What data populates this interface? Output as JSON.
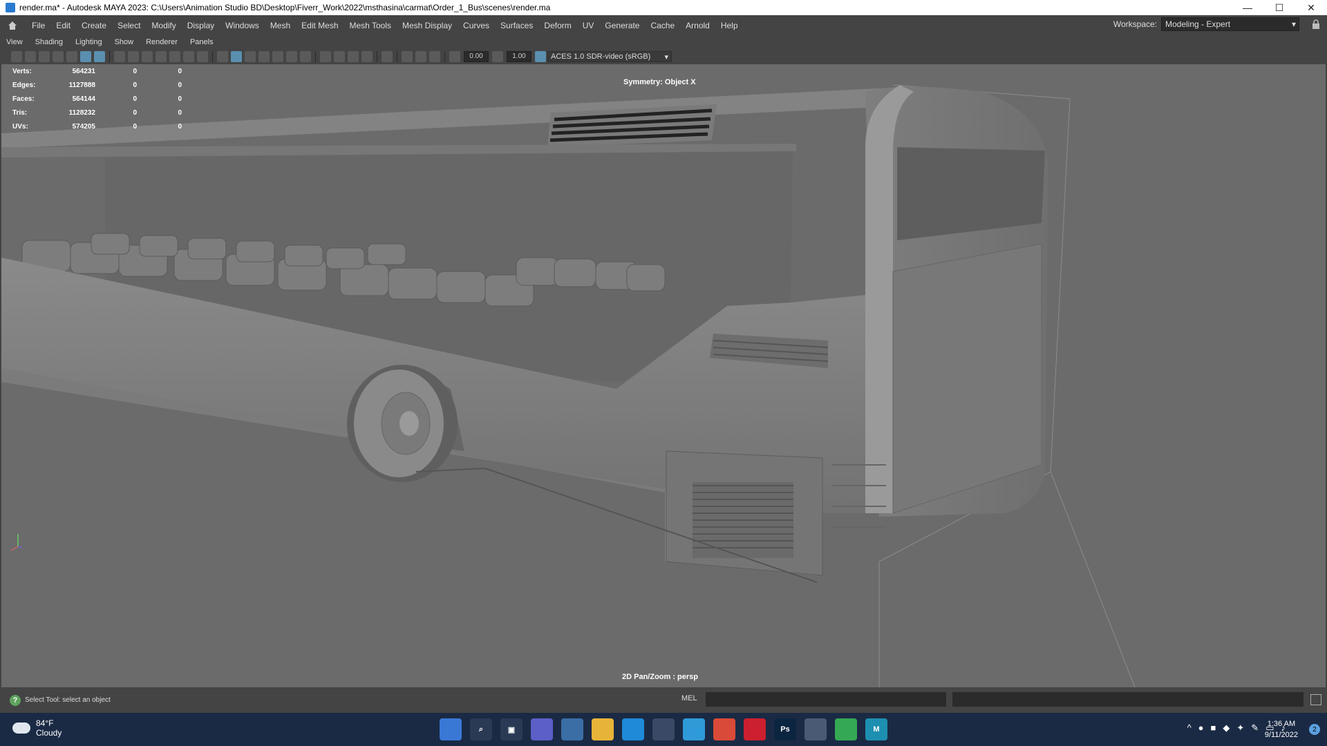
{
  "window": {
    "title": "render.ma* - Autodesk MAYA 2023: C:\\Users\\Animation Studio BD\\Desktop\\Fiverr_Work\\2022\\msthasina\\carmat\\Order_1_Bus\\scenes\\render.ma",
    "minimize": "—",
    "maximize": "☐",
    "close": "✕"
  },
  "menu": {
    "items": [
      "File",
      "Edit",
      "Create",
      "Select",
      "Modify",
      "Display",
      "Windows",
      "Mesh",
      "Edit Mesh",
      "Mesh Tools",
      "Mesh Display",
      "Curves",
      "Surfaces",
      "Deform",
      "UV",
      "Generate",
      "Cache",
      "Arnold",
      "Help"
    ],
    "workspace_label": "Workspace:",
    "workspace_value": "Modeling - Expert"
  },
  "panel_menu": [
    "View",
    "Shading",
    "Lighting",
    "Show",
    "Renderer",
    "Panels"
  ],
  "toolbar": {
    "value_a": "0.00",
    "value_b": "1.00",
    "color_space": "ACES 1.0 SDR-video (sRGB)"
  },
  "hud": {
    "rows": [
      {
        "label": "Verts:",
        "v1": "564231",
        "v2": "0",
        "v3": "0"
      },
      {
        "label": "Edges:",
        "v1": "1127888",
        "v2": "0",
        "v3": "0"
      },
      {
        "label": "Faces:",
        "v1": "564144",
        "v2": "0",
        "v3": "0"
      },
      {
        "label": "Tris:",
        "v1": "1128232",
        "v2": "0",
        "v3": "0"
      },
      {
        "label": "UVs:",
        "v1": "574205",
        "v2": "0",
        "v3": "0"
      }
    ],
    "symmetry": "Symmetry: Object X",
    "camera": "2D Pan/Zoom : persp"
  },
  "status": {
    "help_text": "Select Tool: select an object",
    "mel_label": "MEL"
  },
  "taskbar": {
    "temperature": "84°F",
    "weather": "Cloudy",
    "time": "1:36 AM",
    "date": "9/11/2022",
    "notifications": "2",
    "ps_label": "Ps",
    "maya_label": "M"
  }
}
